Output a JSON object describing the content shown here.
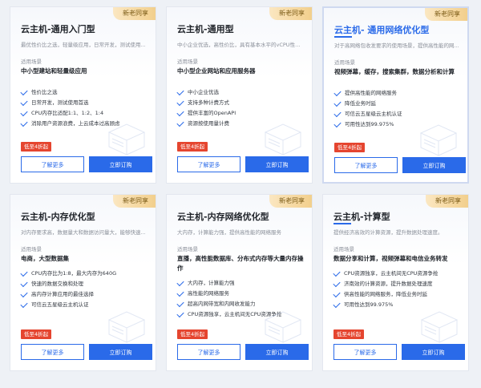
{
  "cards": [
    {
      "badge": "新老同享",
      "title": "云主机-通用入门型",
      "desc": "最优性价比之选，轻量级应用，日常开发，测试使用...",
      "scene_label": "适用场景",
      "scene": "中小型建站和轻量级应用",
      "features": [
        "性价比之选",
        "日常开发，测试使用首选",
        "CPU内存比适配1:1、1:2、1:4",
        "消除用户资源浪费，上云成本过高顾虑"
      ],
      "discount": "低至4折起",
      "more_label": "了解更多",
      "buy_label": "立即订购"
    },
    {
      "badge": "新老同享",
      "title": "云主机-通用型",
      "desc": "中小企业优选，高性价比，具有基本水平的vCPU性能...",
      "scene_label": "适用场景",
      "scene": "中小型企业网站和应用服务器",
      "features": [
        "中小企业优选",
        "支持多种计费方式",
        "提供丰富的OpenAPI",
        "资源按使用量计费"
      ],
      "discount": "低至4折起",
      "more_label": "了解更多",
      "buy_label": "立即订购"
    },
    {
      "badge": "新老同享",
      "title": "云主机- 通用网络优化型",
      "desc": "对于高网络包收发要求的使用场景，提供高性能的网...",
      "scene_label": "适用场景",
      "scene": "视频弹幕，缓存，搜索集群，数据分析和计算",
      "features": [
        "提供高性能的网络服务",
        "降低业务时延",
        "可信云五星级云主机认证",
        "可用性达到99.975%"
      ],
      "discount": "低至4折起",
      "more_label": "了解更多",
      "buy_label": "立即订购",
      "active": true
    },
    {
      "badge": "新老同享",
      "title": "云主机-内存优化型",
      "desc": "对内存要求高，数据量大和数据访问量大，能够快速...",
      "scene_label": "适用场景",
      "scene": "电商，大型数据集",
      "features": [
        "CPU内存比为1:8，最大内存为640G",
        "快速的数据交换和处理",
        "高内存计算应用的最佳选择",
        "可信云五星级云主机认证"
      ],
      "discount": "低至4折起",
      "more_label": "了解更多",
      "buy_label": "立即订购"
    },
    {
      "badge": "新老同享",
      "title": "云主机-内存网络优化型",
      "desc": "大内存，计算能力强，提供高性能的网络服务",
      "scene_label": "适用场景",
      "scene": "直播，高性能数据库、分布式内存等大量内存操作",
      "features": [
        "大内存，计算能力强",
        "高性能的网络服务",
        "超高内网带宽和内网收发能力",
        "CPU资源独享，云主机间无CPU资源争抢"
      ],
      "discount": "低至4折起",
      "more_label": "了解更多",
      "buy_label": "立即订购"
    },
    {
      "badge": "新老同享",
      "title": "云主机-计算型",
      "desc": "提供经济高效的计算资源，提升数据处理速度。",
      "scene_label": "适用场景",
      "scene": "数据分享和计算，视频弹幕和电信业务转发",
      "features": [
        "CPU资源独享，云主机间无CPU资源争抢",
        "济南效的计算资源，提升数据处理速度",
        "供高性能的网络服务，降低业务时延",
        "可用性达到99.975%"
      ],
      "discount": "低至4折起",
      "more_label": "了解更多",
      "buy_label": "立即订购"
    }
  ]
}
